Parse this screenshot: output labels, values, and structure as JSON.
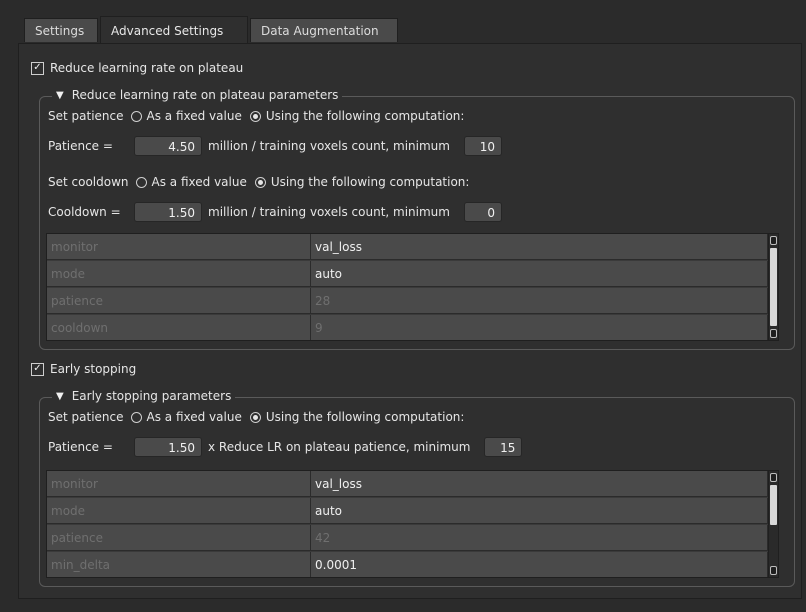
{
  "tabs": [
    "Settings",
    "Advanced Settings",
    "Data Augmentation"
  ],
  "reduce_lr": {
    "checkbox_label": "Reduce learning rate on plateau",
    "checked": true,
    "group_title": "Reduce learning rate on plateau parameters",
    "patience_row": {
      "set_label": "Set patience",
      "option_fixed": "As a fixed value",
      "option_computed": "Using the following computation:",
      "selected": "computed",
      "name_label": "Patience =",
      "factor": "4.50",
      "formula_text": "million / training voxels count,  minimum",
      "minimum": "10"
    },
    "cooldown_row": {
      "set_label": "Set cooldown",
      "option_fixed": "As a fixed value",
      "option_computed": "Using the following computation:",
      "selected": "computed",
      "name_label": "Cooldown =",
      "factor": "1.50",
      "formula_text": "million / training voxels count,  minimum",
      "minimum": "0"
    },
    "params": [
      {
        "key": "monitor",
        "value": "val_loss",
        "enabled": true
      },
      {
        "key": "mode",
        "value": "auto",
        "enabled": true
      },
      {
        "key": "patience",
        "value": "28",
        "enabled": false
      },
      {
        "key": "cooldown",
        "value": "9",
        "enabled": false
      }
    ]
  },
  "early_stopping": {
    "checkbox_label": "Early stopping",
    "checked": true,
    "group_title": "Early stopping parameters",
    "patience_row": {
      "set_label": "Set patience",
      "option_fixed": "As a fixed value",
      "option_computed": "Using the following computation:",
      "selected": "computed",
      "name_label": "Patience =",
      "factor": "1.50",
      "formula_text": "x Reduce LR on plateau patience, minimum",
      "minimum": "15"
    },
    "params": [
      {
        "key": "monitor",
        "value": "val_loss",
        "enabled": true
      },
      {
        "key": "mode",
        "value": "auto",
        "enabled": true
      },
      {
        "key": "patience",
        "value": "42",
        "enabled": false
      },
      {
        "key": "min_delta",
        "value": "0.0001",
        "enabled": true
      }
    ]
  },
  "icons": {
    "checkbox": "checkmark-icon",
    "collapse": "triangle-down-icon",
    "radio": "radio-dot-icon"
  }
}
